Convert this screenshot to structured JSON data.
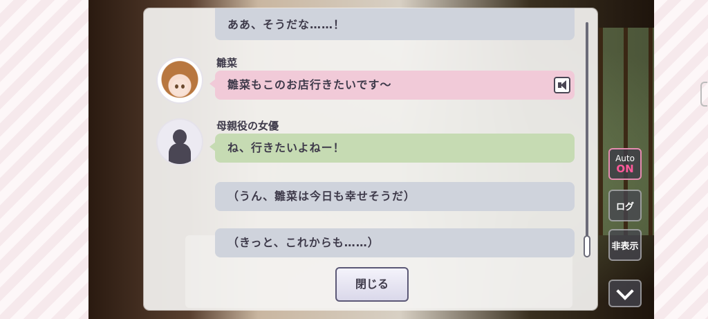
{
  "log": {
    "entries": [
      {
        "speaker": "",
        "text": "ああ、そうだな……！",
        "style": "gray"
      },
      {
        "speaker": "雛菜",
        "text": "雛菜もこのお店行きたいです～",
        "style": "pink",
        "avatar": "hinana-portrait",
        "voice": true
      },
      {
        "speaker": "母親役の女優",
        "text": "ね、行きたいよねー！",
        "style": "green",
        "avatar": "silhouette-icon"
      },
      {
        "speaker": "",
        "text": "（うん、雛菜は今日も幸せそうだ）",
        "style": "gray"
      },
      {
        "speaker": "",
        "text": "（きっと、これからも……）",
        "style": "gray"
      }
    ],
    "close_label": "閉じる"
  },
  "controls": {
    "auto_label": "Auto",
    "auto_state": "ON",
    "log_label": "ログ",
    "hide_label": "非表示"
  },
  "colors": {
    "pink_bubble": "#f1cad8",
    "green_bubble": "#c6dbb3",
    "gray_bubble": "#cfd3dc",
    "auto_on": "#ff5a9a"
  }
}
